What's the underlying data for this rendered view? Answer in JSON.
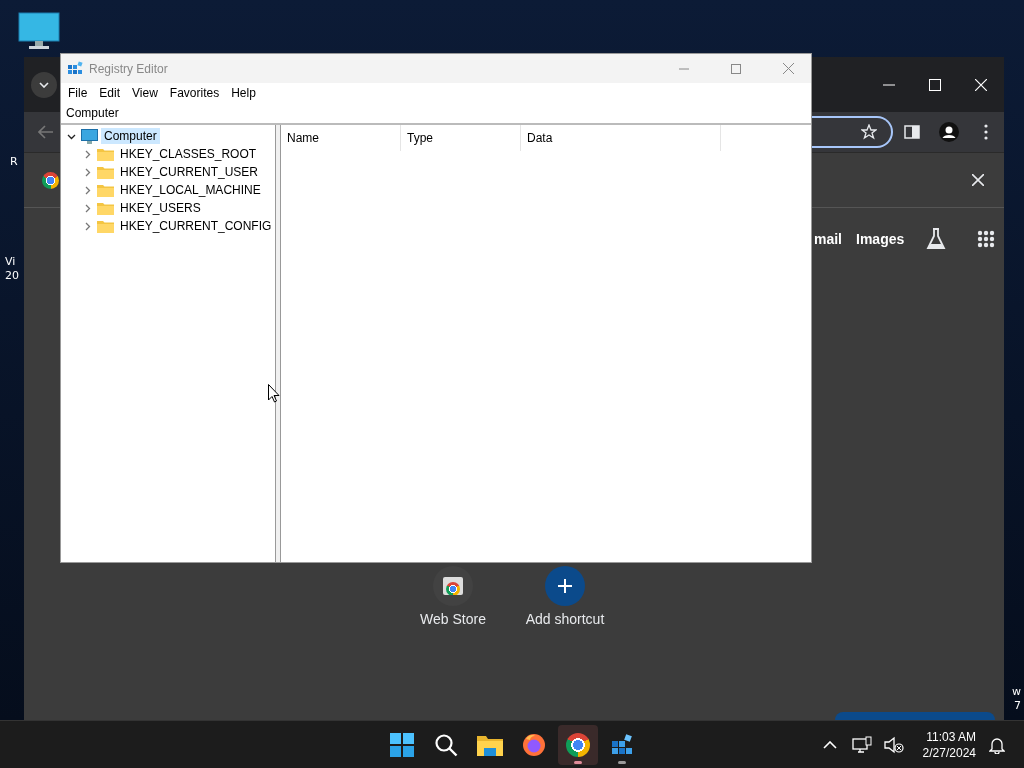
{
  "desktop": {
    "edge_texts": [
      "R",
      "Vi",
      "20",
      "w",
      "7"
    ]
  },
  "browser": {
    "page_links": [
      "mail",
      "Images"
    ],
    "shortcuts": [
      {
        "label": "Web Store",
        "kind": "store"
      },
      {
        "label": "Add shortcut",
        "kind": "add"
      }
    ]
  },
  "registry_editor": {
    "title": "Registry Editor",
    "menu": [
      "File",
      "Edit",
      "View",
      "Favorites",
      "Help"
    ],
    "address": "Computer",
    "tree": [
      {
        "label": "Computer",
        "expanded": true,
        "selected": true,
        "children": [
          {
            "label": "HKEY_CLASSES_ROOT",
            "expanded": false,
            "selected": false
          },
          {
            "label": "HKEY_CURRENT_USER",
            "expanded": false,
            "selected": false
          },
          {
            "label": "HKEY_LOCAL_MACHINE",
            "expanded": false,
            "selected": false
          },
          {
            "label": "HKEY_USERS",
            "expanded": false,
            "selected": false
          },
          {
            "label": "HKEY_CURRENT_CONFIG",
            "expanded": false,
            "selected": false
          }
        ]
      }
    ],
    "columns": [
      "Name",
      "Type",
      "Data"
    ]
  },
  "taskbar": {
    "apps": [
      {
        "kind": "start",
        "active": false,
        "running": false
      },
      {
        "kind": "search",
        "active": false,
        "running": false
      },
      {
        "kind": "explorer",
        "active": false,
        "running": false
      },
      {
        "kind": "firefox",
        "active": false,
        "running": false
      },
      {
        "kind": "chrome",
        "active": true,
        "running": true
      },
      {
        "kind": "regedit",
        "active": false,
        "running": true
      }
    ],
    "time": "11:03 AM",
    "date": "2/27/2024"
  }
}
